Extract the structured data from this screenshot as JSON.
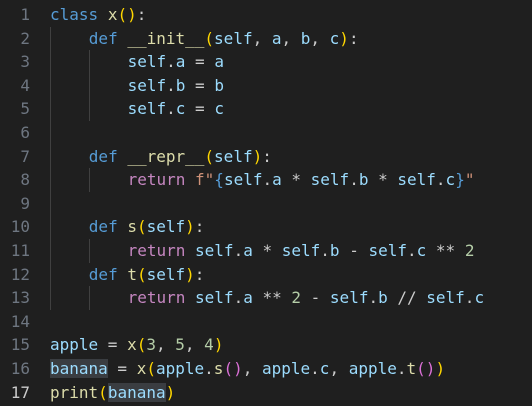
{
  "editor": {
    "language": "python",
    "current_line": "17",
    "lines": [
      {
        "n": "1",
        "t": [
          "class",
          " ",
          "x",
          "(",
          ")",
          ":"
        ]
      },
      {
        "n": "2",
        "t": [
          "def",
          " ",
          "__init__",
          "(",
          "self",
          ", ",
          "a",
          ", ",
          "b",
          ", ",
          "c",
          ")",
          ":"
        ]
      },
      {
        "n": "3",
        "t": [
          "self",
          ".",
          "a",
          " = ",
          "a"
        ]
      },
      {
        "n": "4",
        "t": [
          "self",
          ".",
          "b",
          " = ",
          "b"
        ]
      },
      {
        "n": "5",
        "t": [
          "self",
          ".",
          "c",
          " = ",
          "c"
        ]
      },
      {
        "n": "6",
        "t": []
      },
      {
        "n": "7",
        "t": [
          "def",
          " ",
          "__repr__",
          "(",
          "self",
          ")",
          ":"
        ]
      },
      {
        "n": "8",
        "t": [
          "return",
          " ",
          "f\"",
          "{",
          "self",
          ".",
          "a",
          " * ",
          "self",
          ".",
          "b",
          " * ",
          "self",
          ".",
          "c",
          "}",
          "\""
        ]
      },
      {
        "n": "9",
        "t": []
      },
      {
        "n": "10",
        "t": [
          "def",
          " ",
          "s",
          "(",
          "self",
          ")",
          ":"
        ]
      },
      {
        "n": "11",
        "t": [
          "return",
          " ",
          "self",
          ".",
          "a",
          " * ",
          "self",
          ".",
          "b",
          " - ",
          "self",
          ".",
          "c",
          " ** ",
          "2"
        ]
      },
      {
        "n": "12",
        "t": [
          "def",
          " ",
          "t",
          "(",
          "self",
          ")",
          ":"
        ]
      },
      {
        "n": "13",
        "t": [
          "return",
          " ",
          "self",
          ".",
          "a",
          " ** ",
          "2",
          " - ",
          "self",
          ".",
          "b",
          " // ",
          "self",
          ".",
          "c"
        ]
      },
      {
        "n": "14",
        "t": []
      },
      {
        "n": "15",
        "t": [
          "apple",
          " = ",
          "x",
          "(",
          "3",
          ", ",
          "5",
          ", ",
          "4",
          ")"
        ]
      },
      {
        "n": "16",
        "t": [
          "banana",
          " = ",
          "x",
          "(",
          "apple",
          ".",
          "s",
          "(",
          ")",
          ", ",
          "apple",
          ".",
          "c",
          ", ",
          "apple",
          ".",
          "t",
          "(",
          ")",
          ")"
        ]
      },
      {
        "n": "17",
        "t": [
          "print",
          "(",
          "banana",
          ")"
        ]
      }
    ]
  },
  "theme": {
    "background": "#1f1f1f",
    "keyword": "#569cd6",
    "control_keyword": "#c586c0",
    "function": "#dcdcaa",
    "variable": "#9cdcfe",
    "number": "#b5cea8",
    "string": "#ce9178",
    "bracket_level_1": "#ffd700",
    "bracket_level_2": "#da70d6",
    "bracket_level_3": "#179fff",
    "line_number": "#6e7681",
    "current_line_number": "#cccccc",
    "word_highlight": "#3a3d41"
  }
}
